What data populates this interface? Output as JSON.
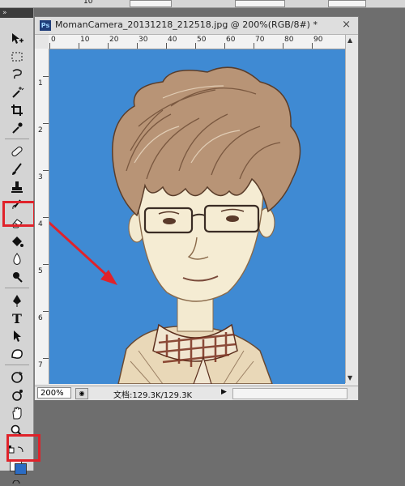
{
  "optionsbar": {
    "value": "10"
  },
  "document": {
    "badge": "Ps",
    "title": "MomanCamera_20131218_212518.jpg @ 200%(RGB/8#) *",
    "close": "×",
    "ruler_top": [
      "0",
      "10",
      "20",
      "30",
      "40",
      "50",
      "60",
      "70",
      "80",
      "90"
    ],
    "ruler_left": [
      "1",
      "2",
      "3",
      "4",
      "5",
      "6",
      "7"
    ],
    "zoom": "200%",
    "doc_size": "文档:129.3K/129.3K"
  },
  "toolbox": {
    "grip": "»",
    "tools": [
      "move-tool",
      "marquee-tool",
      "lasso-tool",
      "magic-wand-tool",
      "crop-tool",
      "eyedropper-tool",
      "healing-brush-tool",
      "brush-tool",
      "clone-stamp-tool",
      "history-brush-tool",
      "eraser-tool",
      "paint-bucket-tool",
      "blur-tool",
      "dodge-tool",
      "pen-tool",
      "type-tool",
      "path-selection-tool",
      "custom-shape-tool",
      "notes-tool",
      "eyedropper-3d-tool",
      "hand-tool",
      "zoom-tool"
    ],
    "type_glyph": "T",
    "highlight_color": "#e0222a"
  },
  "colors": {
    "canvas_bg": "#3f8ad3",
    "arrow": "#e0222a"
  }
}
